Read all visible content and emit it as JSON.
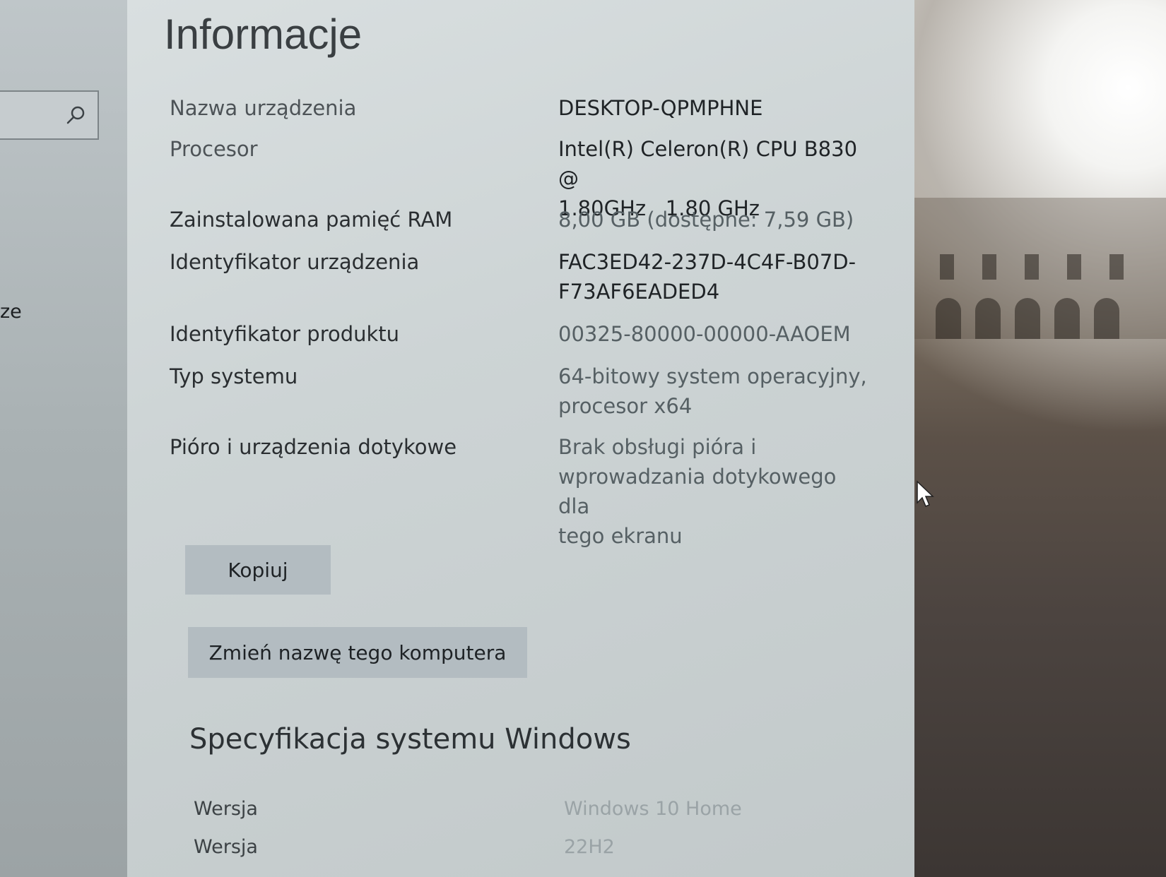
{
  "nav": {
    "search_placeholder": "",
    "fragment_text": "ze"
  },
  "page": {
    "title": "Informacje"
  },
  "device_specs": {
    "device_name": {
      "label": "Nazwa urządzenia",
      "value": "DESKTOP-QPMPHNE"
    },
    "processor": {
      "label": "Procesor",
      "value_line1": "Intel(R) Celeron(R) CPU B830 @",
      "value_line2": "1.80GHz   1.80 GHz"
    },
    "ram": {
      "label": "Zainstalowana pamięć RAM",
      "value": "8,00 GB (dostępne: 7,59 GB)"
    },
    "device_id": {
      "label": "Identyfikator urządzenia",
      "value_line1": "FAC3ED42-237D-4C4F-B07D-",
      "value_line2": "F73AF6EADED4"
    },
    "product_id": {
      "label": "Identyfikator produktu",
      "value": "00325-80000-00000-AAOEM"
    },
    "system_type": {
      "label": "Typ systemu",
      "value_line1": "64-bitowy system operacyjny,",
      "value_line2": "procesor x64"
    },
    "pen_touch": {
      "label": "Pióro i urządzenia dotykowe",
      "value_line1": "Brak obsługi pióra i",
      "value_line2": "wprowadzania dotykowego dla",
      "value_line3": "tego ekranu"
    }
  },
  "buttons": {
    "copy_label": "Kopiuj",
    "rename_label": "Zmień nazwę tego komputera"
  },
  "windows_specs": {
    "heading": "Specyfikacja systemu Windows",
    "edition": {
      "label": "Wersja",
      "value": "Windows 10 Home"
    },
    "version": {
      "label": "Wersja",
      "value": "22H2"
    }
  },
  "icons": {
    "search": "search-icon",
    "cursor": "mouse-cursor-icon"
  },
  "colors": {
    "content_background": "#cdd4d5",
    "button_background": "#b3bcc1",
    "text_primary": "#1f2326"
  }
}
